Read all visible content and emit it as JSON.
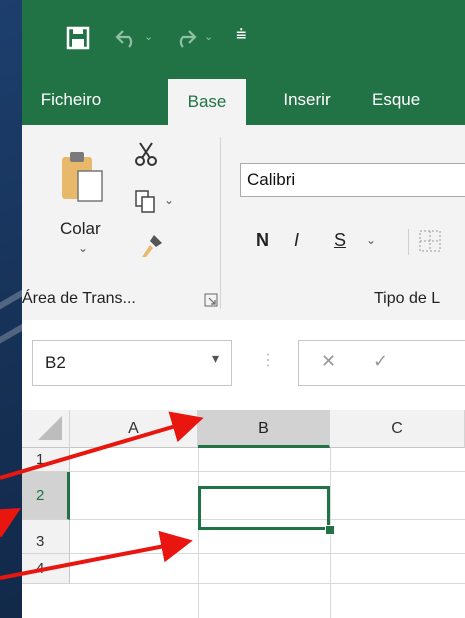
{
  "quick_access": {
    "save_icon": "save-icon",
    "undo_icon": "undo-icon",
    "redo_icon": "redo-icon",
    "customize_icon": "customize-qat-icon"
  },
  "tabs": [
    {
      "label": "Ficheiro"
    },
    {
      "label": "Base",
      "active": true
    },
    {
      "label": "Inserir"
    },
    {
      "label": "Esque"
    }
  ],
  "ribbon": {
    "clipboard": {
      "paste_label": "Colar",
      "group_label": "Área de Trans..."
    },
    "font": {
      "font_name": "Calibri",
      "bold": "N",
      "italic": "I",
      "underline": "S",
      "group_label": "Tipo de L"
    }
  },
  "formula_bar": {
    "name_box": "B2",
    "cancel": "✕",
    "enter": "✓"
  },
  "grid": {
    "columns": [
      "A",
      "B",
      "C"
    ],
    "rows": [
      "1",
      "2",
      "3",
      "4"
    ],
    "selected_column": "B",
    "selected_row": "2"
  },
  "colors": {
    "accent": "#217346",
    "arrows": "#e8160f"
  }
}
